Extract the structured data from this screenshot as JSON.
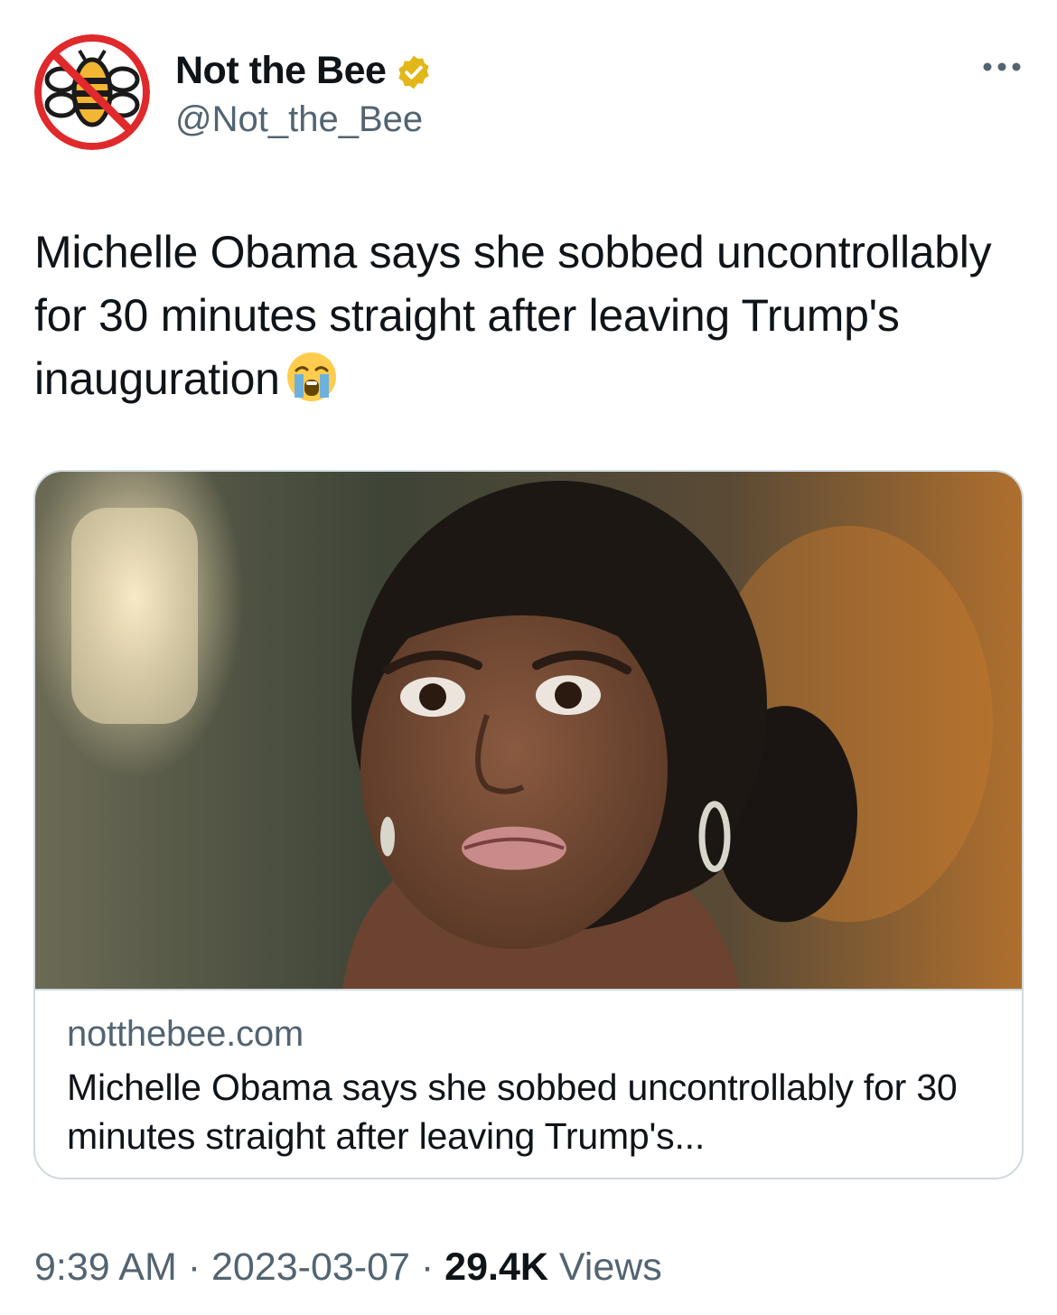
{
  "tweet": {
    "author": {
      "display_name": "Not the Bee",
      "handle": "@Not_the_Bee",
      "verified_color": "#e2b719",
      "avatar_icon": "crossed-out-bee-logo"
    },
    "more_icon": "ellipsis-icon",
    "text": "Michelle Obama says she sobbed uncontrollably for 30 minutes straight after leaving Trump's inauguration",
    "text_emoji": "loudly-crying-face",
    "link_card": {
      "domain": "notthebee.com",
      "title": "Michelle Obama says she sobbed uncontrollably for 30 minutes straight after leaving Trump's..."
    },
    "meta": {
      "time": "9:39 AM",
      "separator": " · ",
      "date": "2023-03-07",
      "views_count": "29.4K",
      "views_label": " Views"
    }
  },
  "colors": {
    "text_primary": "#0f1419",
    "text_secondary": "#536471",
    "border": "#cfd9de",
    "logo_red": "#e0292b",
    "logo_gold": "#f2b632"
  }
}
